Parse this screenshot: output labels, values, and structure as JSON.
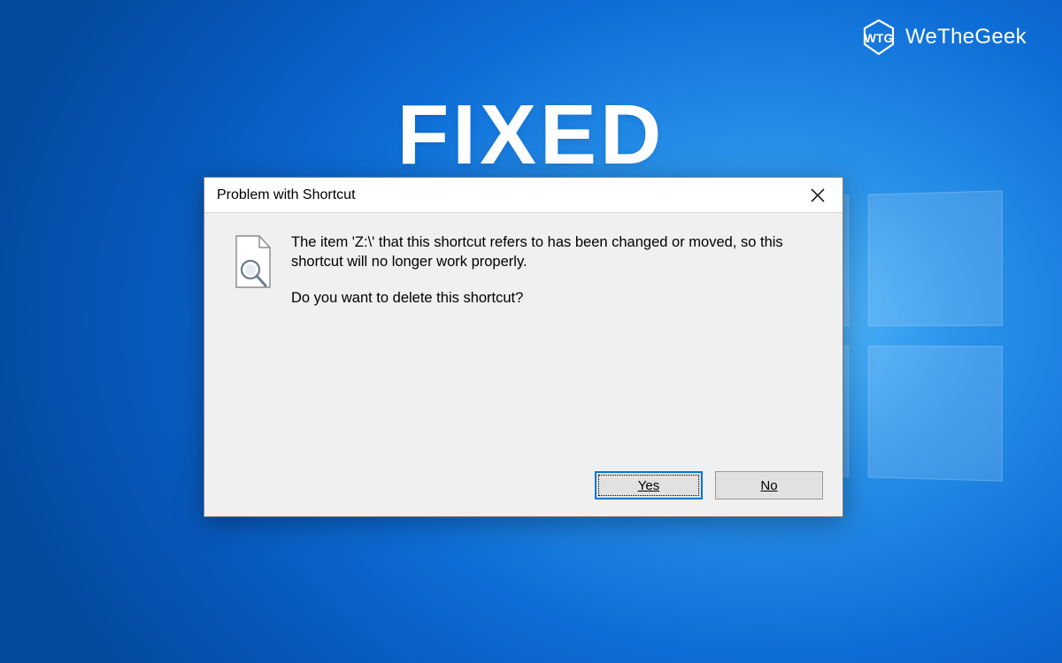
{
  "brand": {
    "name": "WeTheGeek",
    "icon_label": "wethegeek-logo"
  },
  "headline": "FIXED",
  "dialog": {
    "title": "Problem with Shortcut",
    "close_label": "Close",
    "message_main": "The item 'Z:\\' that this shortcut refers to has been changed or moved, so this shortcut will no longer work properly.",
    "message_question": "Do you want to delete this shortcut?",
    "buttons": {
      "yes": "Yes",
      "no": "No"
    },
    "icon_label": "file-search-icon"
  },
  "colors": {
    "accent": "#0078d7",
    "dialog_bg": "#f0f0f0",
    "desktop_primary": "#0d6dd6"
  }
}
